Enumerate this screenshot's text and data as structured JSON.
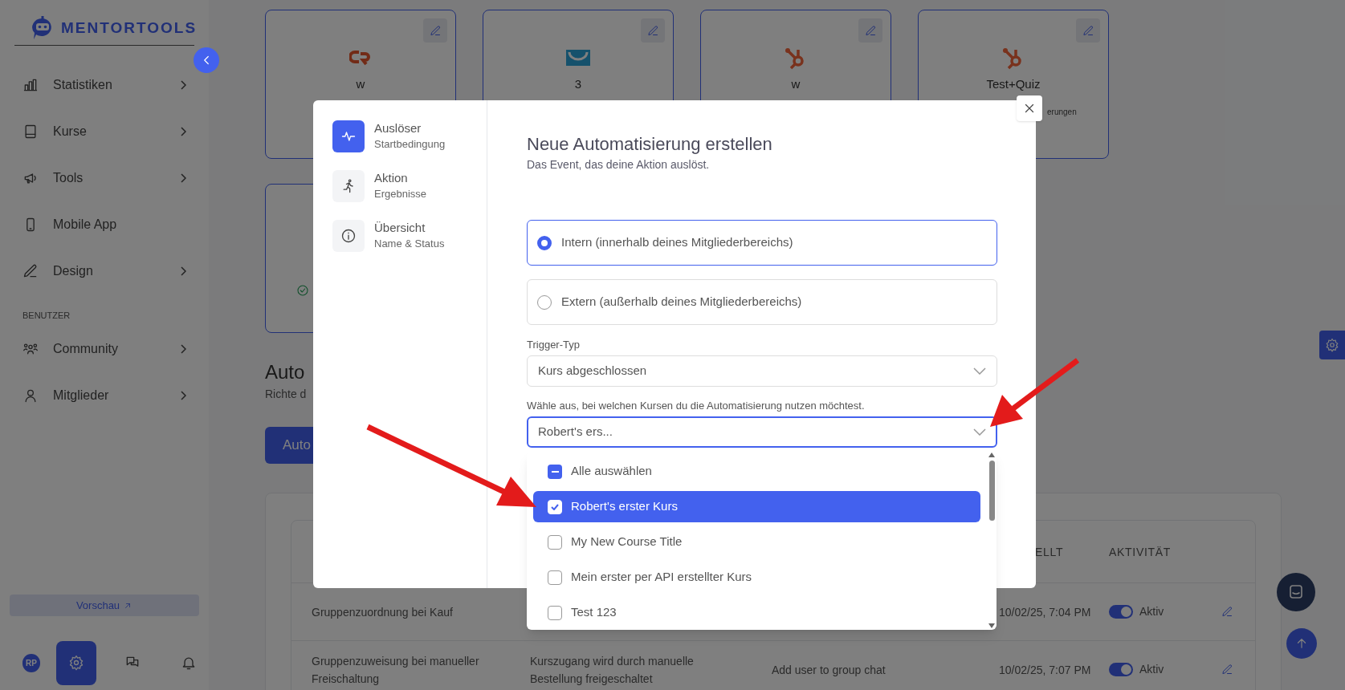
{
  "sidebar": {
    "logo": "MENTORTOOLS",
    "items": [
      {
        "label": "Statistiken",
        "has_children": true
      },
      {
        "label": "Kurse",
        "has_children": true
      },
      {
        "label": "Tools",
        "has_children": true
      },
      {
        "label": "Mobile App",
        "has_children": false
      },
      {
        "label": "Design",
        "has_children": true
      }
    ],
    "section_label": "BENUTZER",
    "user_items": [
      {
        "label": "Community",
        "has_children": true
      },
      {
        "label": "Mitglieder",
        "has_children": true
      }
    ],
    "preview_button": "Vorschau",
    "avatar": "RP",
    "bottom_tabs": [
      {
        "selected": true
      },
      {
        "selected": false
      },
      {
        "selected": false
      }
    ]
  },
  "integration_cards": [
    {
      "title": "w"
    },
    {
      "title": "3"
    },
    {
      "title": "w"
    },
    {
      "title": "Test+Quiz",
      "subtitle": "erungen"
    }
  ],
  "section": {
    "title": "Auto",
    "subtitle": "Richte d",
    "button": "Auto"
  },
  "table": {
    "columns": [
      "ELLT",
      "AKTIVITÄT"
    ],
    "rows": [
      {
        "name": "Gruppenzuordnung bei Kauf",
        "created": "10/02/25, 7:04 PM",
        "active": true,
        "status": "Aktiv"
      },
      {
        "name": "Gruppenzuweisung bei manueller Freischaltung",
        "trigger": "Kurszugang wird durch manuelle Bestellung freigeschaltet",
        "action": "Add user to group chat",
        "created": "10/02/25, 7:07 PM",
        "active": true,
        "status": "Aktiv"
      }
    ]
  },
  "modal": {
    "steps": [
      {
        "title": "Auslöser",
        "subtitle": "Startbedingung",
        "selected": true
      },
      {
        "title": "Aktion",
        "subtitle": "Ergebnisse",
        "selected": false
      },
      {
        "title": "Übersicht",
        "subtitle": "Name & Status",
        "selected": false
      }
    ],
    "title": "Neue Automatisierung erstellen",
    "subtitle": "Das Event, das deine Aktion auslöst.",
    "options": [
      {
        "label": "Intern (innerhalb deines Mitgliederbereichs)",
        "selected": true
      },
      {
        "label": "Extern (außerhalb deines Mitgliederbereichs)",
        "selected": false
      }
    ],
    "trigger_label": "Trigger-Typ",
    "trigger_value": "Kurs abgeschlossen",
    "course_label": "Wähle aus, bei welchen Kursen du die Automatisierung nutzen möchtest.",
    "course_value": "Robert's ers...",
    "select_all": {
      "label": "Alle auswählen",
      "indeterminate": true
    },
    "courses": [
      {
        "label": "Robert's erster Kurs",
        "checked": true,
        "highlighted": true
      },
      {
        "label": "My New Course Title",
        "checked": false,
        "highlighted": false
      },
      {
        "label": "Mein erster per API erstellter Kurs",
        "checked": false,
        "highlighted": false
      },
      {
        "label": "Test 123",
        "checked": false,
        "highlighted": false
      }
    ]
  }
}
